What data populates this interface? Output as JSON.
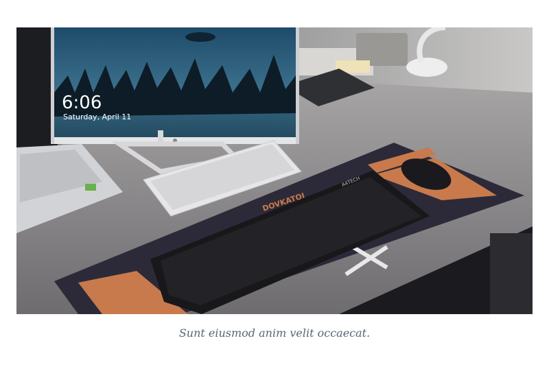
{
  "figure": {
    "monitor_time": "6:06",
    "monitor_date": "Saturday, April 11",
    "mousepad_brand": "DOVKATOI",
    "keyboard_brand": "A4TECH",
    "caption": "Sunt eiusmod anim velit occaecat."
  },
  "colors": {
    "caption": "#596479",
    "desk": "#8d8a8a",
    "mousepad": "#2c2a38",
    "accent_orange": "#c97a4c"
  }
}
